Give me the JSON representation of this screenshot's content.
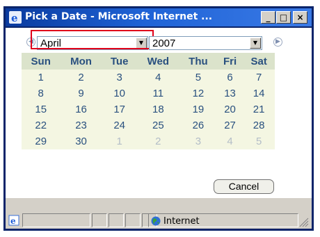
{
  "window": {
    "title": "Pick a Date - Microsoft Internet ...",
    "controls": {
      "minimize": "_",
      "maximize": "□",
      "close": "×"
    }
  },
  "picker": {
    "prev_icon": "circle-left-arrow-icon",
    "next_icon": "circle-right-arrow-icon",
    "month_select": {
      "value": "April"
    },
    "year_select": {
      "value": "2007"
    }
  },
  "calendar": {
    "weekdays": [
      "Sun",
      "Mon",
      "Tue",
      "Wed",
      "Thu",
      "Fri",
      "Sat"
    ],
    "weeks": [
      [
        {
          "d": "1"
        },
        {
          "d": "2"
        },
        {
          "d": "3"
        },
        {
          "d": "4"
        },
        {
          "d": "5"
        },
        {
          "d": "6"
        },
        {
          "d": "7"
        }
      ],
      [
        {
          "d": "8"
        },
        {
          "d": "9"
        },
        {
          "d": "10"
        },
        {
          "d": "11"
        },
        {
          "d": "12"
        },
        {
          "d": "13"
        },
        {
          "d": "14"
        }
      ],
      [
        {
          "d": "15"
        },
        {
          "d": "16"
        },
        {
          "d": "17"
        },
        {
          "d": "18"
        },
        {
          "d": "19"
        },
        {
          "d": "20"
        },
        {
          "d": "21"
        }
      ],
      [
        {
          "d": "22"
        },
        {
          "d": "23"
        },
        {
          "d": "24"
        },
        {
          "d": "25"
        },
        {
          "d": "26"
        },
        {
          "d": "27"
        },
        {
          "d": "28"
        }
      ],
      [
        {
          "d": "29"
        },
        {
          "d": "30"
        },
        {
          "d": "1",
          "other": true
        },
        {
          "d": "2",
          "other": true
        },
        {
          "d": "3",
          "other": true
        },
        {
          "d": "4",
          "other": true
        },
        {
          "d": "5",
          "other": true
        }
      ]
    ]
  },
  "buttons": {
    "cancel": "Cancel"
  },
  "status": {
    "zone": "Internet"
  },
  "colors": {
    "title_bar": "#1f63d6",
    "header_bg": "#dbe3cb",
    "day_text": "#29507f",
    "other_month_text": "#b3bdc7",
    "highlight": "#e0001a"
  }
}
